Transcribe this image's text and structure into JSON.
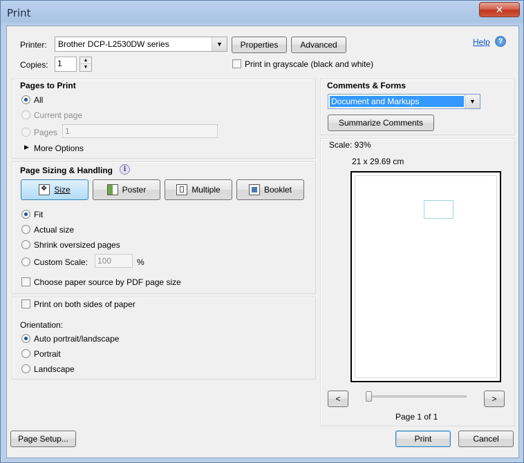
{
  "window": {
    "title": "Print",
    "close_symbol": "✕"
  },
  "printer": {
    "printer_label": "Printer:",
    "printer_value": "Brother DCP-L2530DW series",
    "properties_label": "Properties",
    "advanced_label": "Advanced",
    "help_label": "Help",
    "copies_label": "Copies:",
    "copies_value": "1",
    "grayscale_label": "Print in grayscale (black and white)"
  },
  "pages_to_print": {
    "title": "Pages to Print",
    "all_label": "All",
    "current_label": "Current page",
    "pages_label": "Pages",
    "pages_value": "1",
    "more_options_label": "More Options"
  },
  "sizing": {
    "title": "Page Sizing & Handling",
    "buttons": [
      "Size",
      "Poster",
      "Multiple",
      "Booklet"
    ],
    "fit_label": "Fit",
    "actual_label": "Actual size",
    "shrink_label": "Shrink oversized pages",
    "custom_label": "Custom Scale:",
    "custom_value": "100",
    "percent": "%",
    "paper_source_label": "Choose paper source by PDF page size"
  },
  "duplex": {
    "both_sides_label": "Print on both sides of paper",
    "orientation_label": "Orientation:",
    "auto_label": "Auto portrait/landscape",
    "portrait_label": "Portrait",
    "landscape_label": "Landscape"
  },
  "comments": {
    "title": "Comments & Forms",
    "value": "Document and Markups",
    "summarize_label": "Summarize Comments"
  },
  "preview": {
    "scale_text": "Scale:  93%",
    "dimensions": "21 x 29.69 cm",
    "prev_symbol": "<",
    "next_symbol": ">",
    "page_text": "Page 1 of 1"
  },
  "footer": {
    "page_setup_label": "Page Setup...",
    "print_label": "Print",
    "cancel_label": "Cancel"
  },
  "colors": {
    "accent": "#3399ff",
    "selection": "#3399ff"
  }
}
